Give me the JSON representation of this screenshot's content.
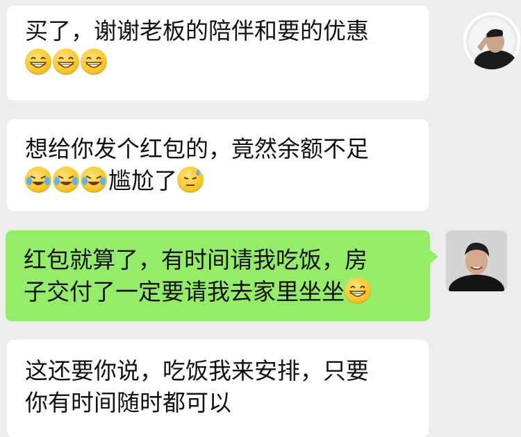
{
  "messages": [
    {
      "line1": "买了，谢谢老板的陪伴和要的优惠",
      "emojis": [
        "grin",
        "grin",
        "grin"
      ]
    },
    {
      "line1": "想给你发个红包的，竟然余额不足",
      "emojis": [
        "laugh-cry",
        "laugh-cry",
        "laugh-cry"
      ],
      "tail_text": "尴尬了",
      "end_emoji": "sweat"
    },
    {
      "line1": "红包就算了，有时间请我吃饭，房",
      "line2": "子交付了一定要请我去家里坐坐",
      "end_emoji": "grin"
    },
    {
      "line1": "这还要你说，吃饭我来安排，只要",
      "line2": "你有时间随时都可以"
    }
  ],
  "colors": {
    "background": "#ededed",
    "received_bubble": "#ffffff",
    "sent_bubble": "#95ec69",
    "text": "#111111"
  }
}
